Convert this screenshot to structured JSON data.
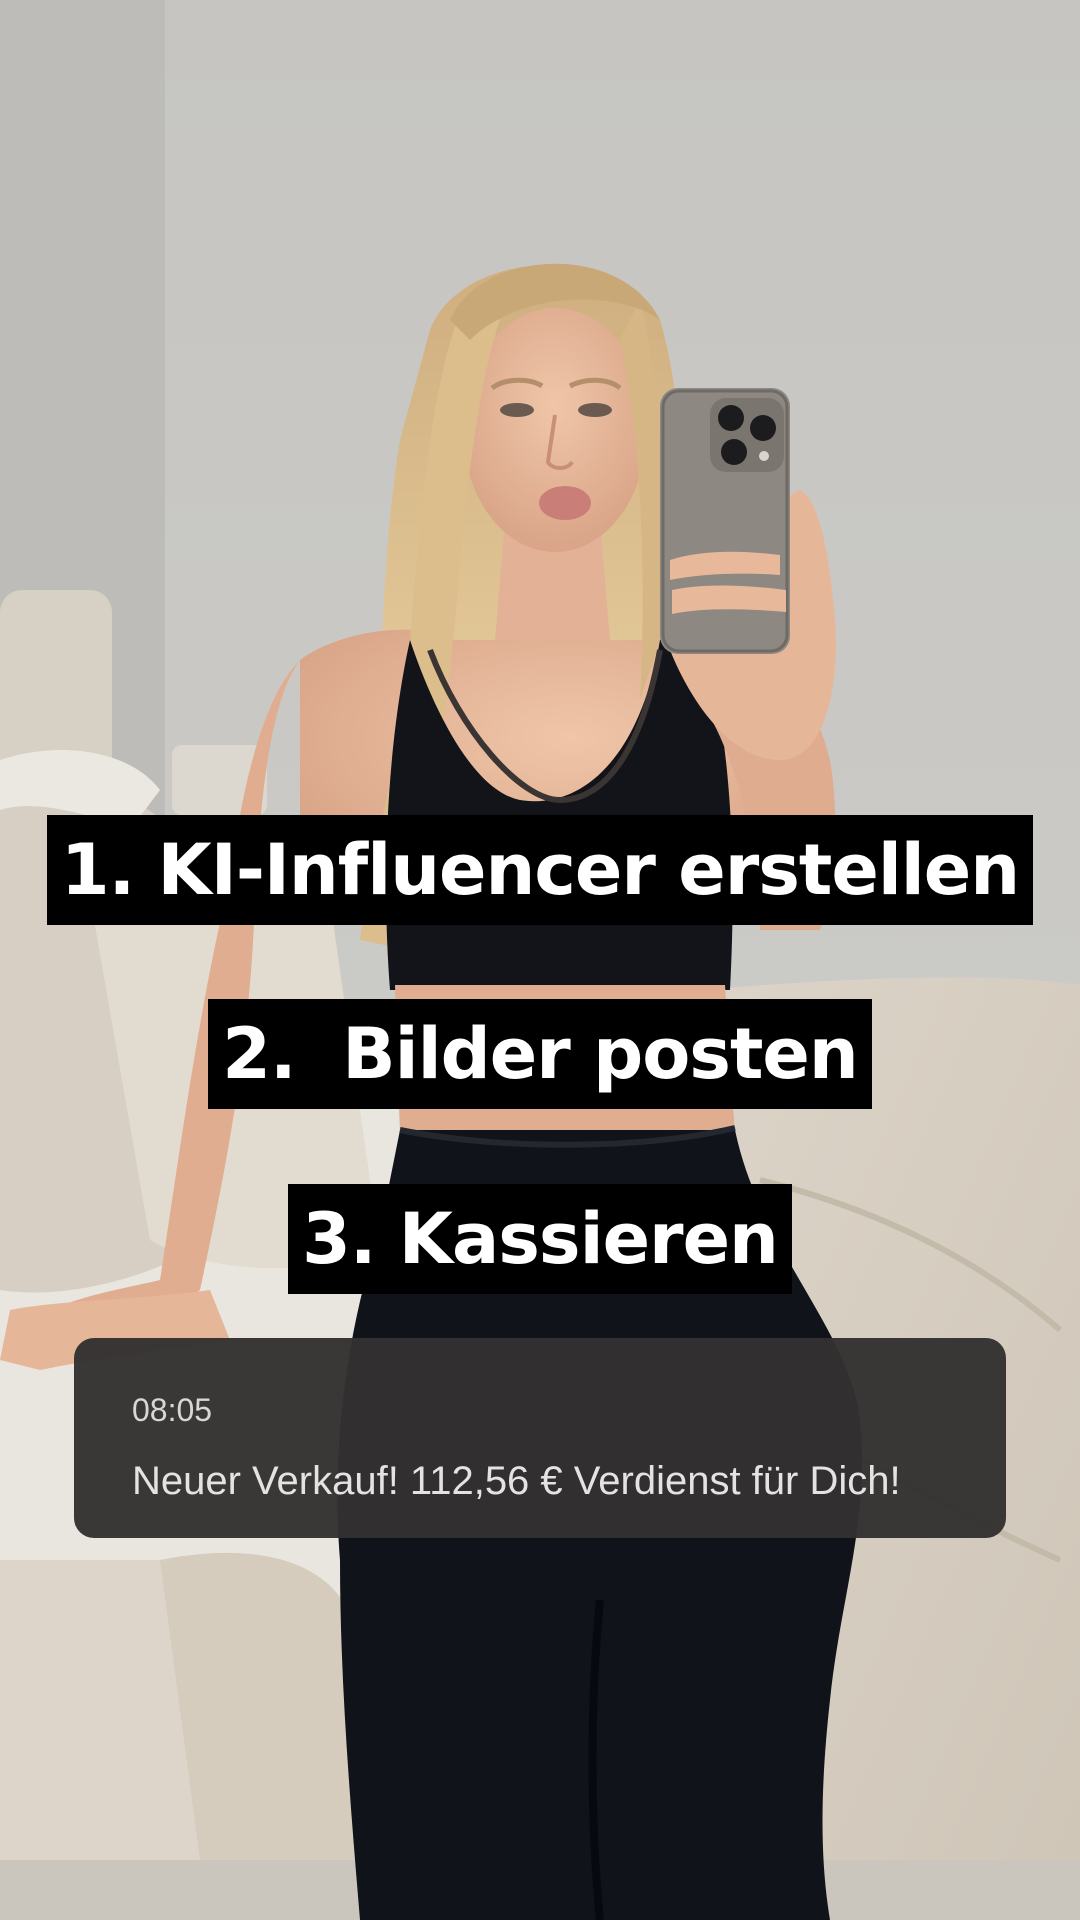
{
  "captions": [
    "1. KI-Influencer erstellen",
    "2.  Bilder posten",
    "3. Kassieren"
  ],
  "notification": {
    "time": "08:05",
    "message": "Neuer Verkauf! 112,56 € Verdienst für Dich!"
  },
  "photo": {
    "subject": "mirror-selfie-photo",
    "colors": {
      "wall": "#c7c6c2",
      "outfit": "#111418",
      "hair": "#d8b98a",
      "skin": "#e6b79a",
      "bedding": "#d9d0c2",
      "phone": "#8d8882"
    }
  }
}
